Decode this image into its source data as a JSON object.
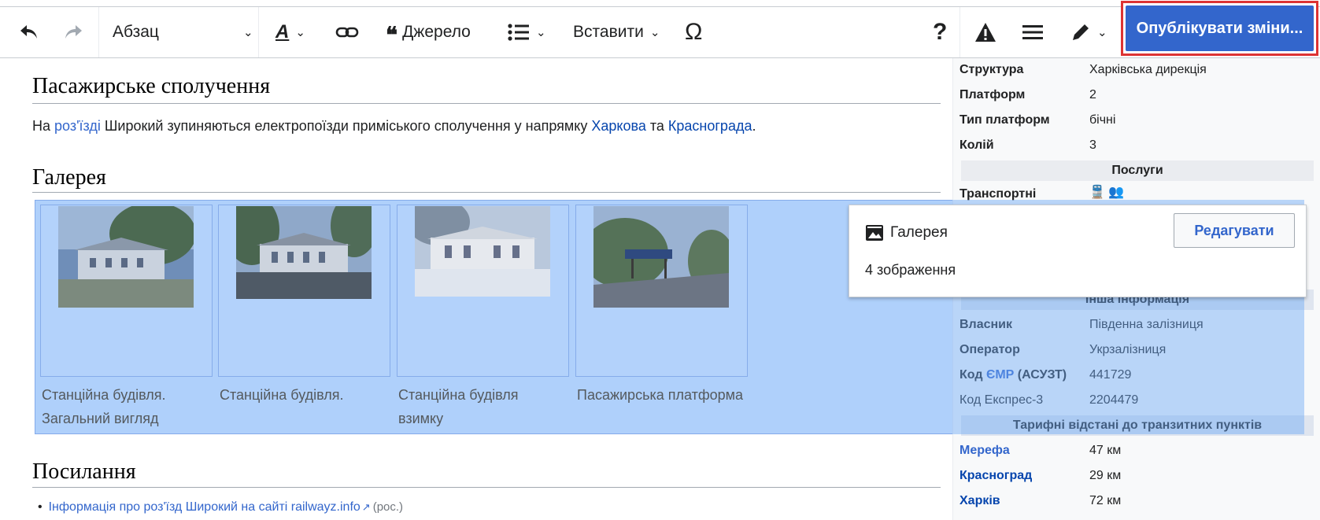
{
  "toolbar": {
    "format_label": "Абзац",
    "cite_label": "Джерело",
    "insert_label": "Вставити",
    "publish_label": "Опублікувати зміни...",
    "help_glyph": "?",
    "special_char_glyph": "Ω"
  },
  "article": {
    "section1_title": "Пасажирське сполучення",
    "paragraph": {
      "t1": "На ",
      "l1": "роз'їзді",
      "t2": " Широкий зупиняються електропоїзди приміського сполучення у напрямку ",
      "l2": "Харкова",
      "t3": " та ",
      "l3": "Краснограда",
      "t4": "."
    },
    "section2_title": "Галерея",
    "gallery": [
      {
        "caption_l1": "Станційна будівля.",
        "caption_l2": "Загальний вигляд"
      },
      {
        "caption_l1": "Станційна будівля.",
        "caption_l2": ""
      },
      {
        "caption_l1": "Станційна будівля",
        "caption_l2": "взимку"
      },
      {
        "caption_l1": "Пасажирська платформа",
        "caption_l2": ""
      }
    ],
    "section3_title": "Посилання",
    "ref_link": "Інформація про роз'їзд Широкий на сайті railwayz.info",
    "ref_lang": "(рос.)"
  },
  "infobox": {
    "rows_top": [
      {
        "k": "Структура",
        "v": "Харківська дирекція"
      },
      {
        "k": "Платформ",
        "v": "2"
      },
      {
        "k": "Тип платформ",
        "v": "бічні"
      },
      {
        "k": "Колій",
        "v": "3"
      }
    ],
    "services_header": "Послуги",
    "transport_label": "Транспортні",
    "other_header": "Інша інформація",
    "owner_k": "Власник",
    "owner_v": "Південна залізниця",
    "operator_k": "Оператор",
    "operator_v": "Укрзалізниця",
    "code_k_pre": "Код ",
    "code_k_link": "ЄМР",
    "code_k_post": " (АСУЗТ)",
    "code_v": "441729",
    "express_k": "Код Експрес-3",
    "express_v": "2204479",
    "tariff_header": "Тарифні відстані до транзитних пунктів",
    "tariff": [
      {
        "k": "Мерефа",
        "v": "47 км"
      },
      {
        "k": "Красноград",
        "v": "29 км"
      },
      {
        "k": "Харків",
        "v": "72 км"
      }
    ]
  },
  "popup": {
    "title": "Галерея",
    "count": "4 зображення",
    "edit_label": "Редагувати"
  }
}
